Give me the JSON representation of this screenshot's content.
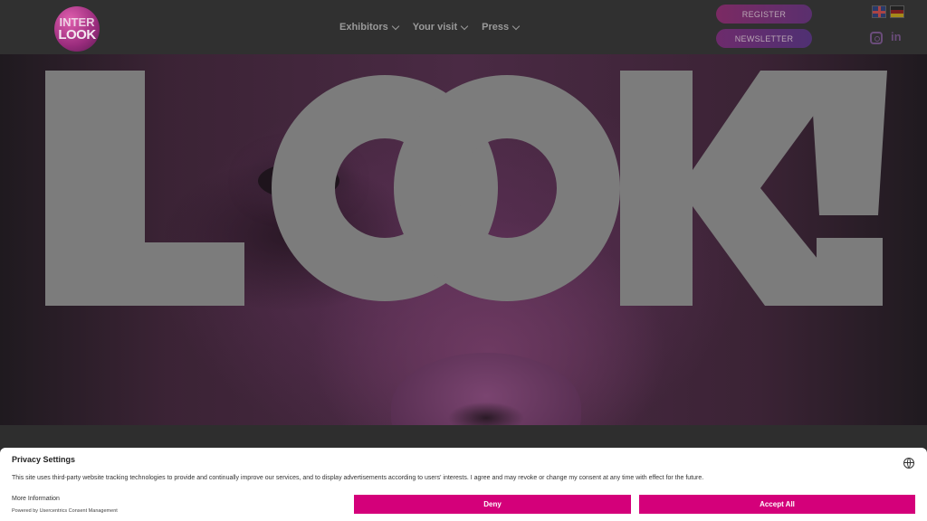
{
  "header": {
    "logo": {
      "line1": "INTER",
      "line2": "LOOK"
    },
    "nav": [
      {
        "label": "Exhibitors"
      },
      {
        "label": "Your visit"
      },
      {
        "label": "Press"
      }
    ],
    "register_label": "REGISTER",
    "newsletter_label": "NEWSLETTER",
    "flags": [
      "flag-en-icon",
      "flag-de-icon"
    ],
    "social": {
      "linkedin": "in"
    }
  },
  "hero": {
    "headline": "LOOK!"
  },
  "consent": {
    "title": "Privacy Settings",
    "text": "This site uses third-party website tracking technologies to provide and continually improve our services, and to display advertisements according to users' interests. I agree and may revoke or change my consent at any time with effect for the future.",
    "more_info": "More Information",
    "powered_by": "Powered by Usercentrics Consent Management",
    "deny_label": "Deny",
    "accept_label": "Accept All"
  },
  "colors": {
    "accent": "#d4007a",
    "header_bg": "#303030",
    "hero_word": "#7c7c7c"
  }
}
